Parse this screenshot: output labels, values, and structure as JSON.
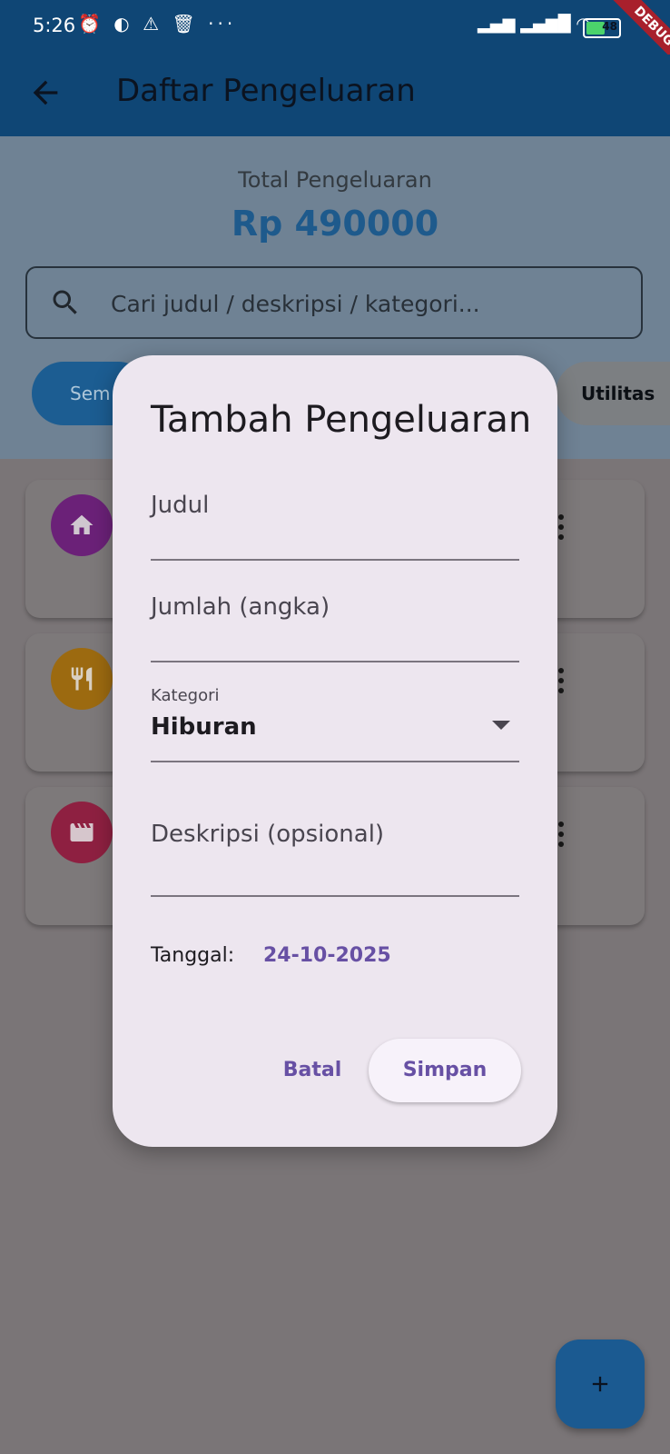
{
  "status_bar": {
    "time": "5:26",
    "battery": "48",
    "debug_label": "DEBUG"
  },
  "app_bar": {
    "title": "Daftar Pengeluaran"
  },
  "summary": {
    "total_label": "Total Pengeluaran",
    "total_value": "Rp 490000"
  },
  "search": {
    "placeholder": "Cari judul / deskripsi / kategori..."
  },
  "filters": [
    {
      "label": "Semua",
      "visible_text": "Sem"
    },
    {
      "label": "Utilitas",
      "visible_text": "Utilitas"
    }
  ],
  "expense_cards": [
    {
      "icon": "home-icon",
      "color": "#7b1f8a"
    },
    {
      "icon": "restaurant-icon",
      "color": "#c67a00"
    },
    {
      "icon": "movie-icon",
      "color": "#b4123f"
    }
  ],
  "dialog": {
    "title": "Tambah Pengeluaran",
    "fields": {
      "judul_label": "Judul",
      "jumlah_label": "Jumlah (angka)",
      "kategori_label": "Kategori",
      "kategori_value": "Hiburan",
      "deskripsi_label": "Deskripsi (opsional)"
    },
    "date_label": "Tanggal:",
    "date_value": "24-10-2025",
    "cancel_label": "Batal",
    "save_label": "Simpan"
  },
  "fab": {
    "icon": "add-icon",
    "label": "+"
  },
  "colors": {
    "primary": "#1976d2",
    "dialog_accent": "#6750a4"
  }
}
